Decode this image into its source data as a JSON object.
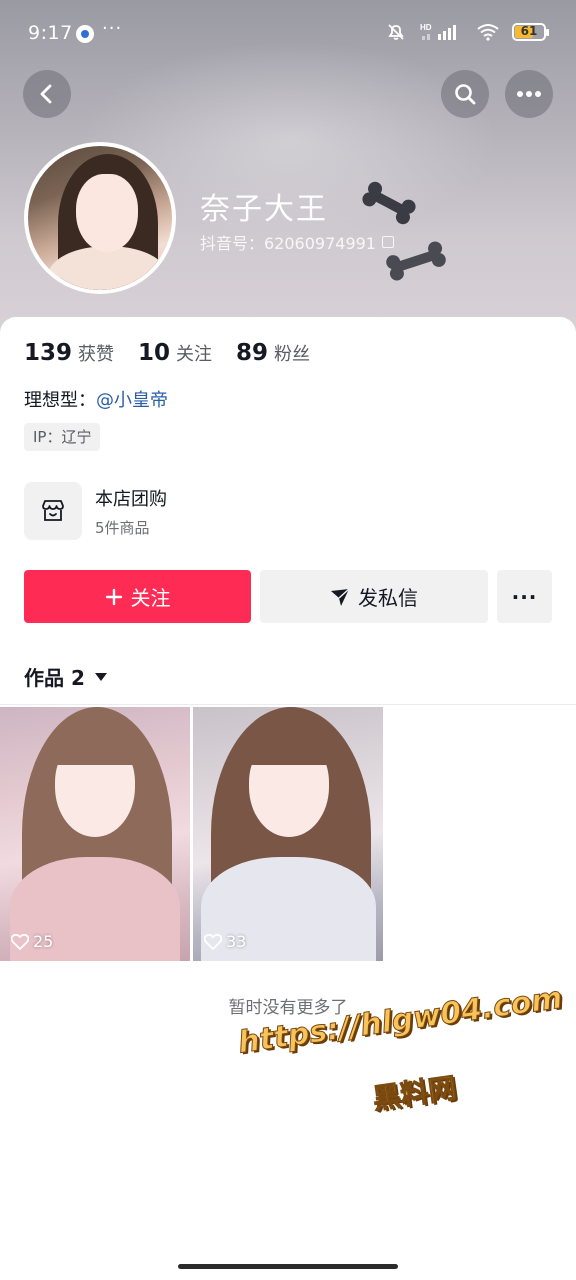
{
  "status_bar": {
    "time": "9:17",
    "dots": "···",
    "signal_label": "HD",
    "battery": {
      "level": 61,
      "label": "61",
      "color": "#f5b932"
    }
  },
  "header": {
    "back_icon": "chevron-left-icon",
    "search_icon": "search-icon",
    "more_icon": "ellipsis-icon"
  },
  "profile": {
    "nickname": "奈子大王",
    "douyin_id": "抖音号：62060974991"
  },
  "stats": {
    "likes": {
      "value": "139",
      "label": "获赞"
    },
    "following": {
      "value": "10",
      "label": "关注"
    },
    "followers": {
      "value": "89",
      "label": "粉丝"
    }
  },
  "bio": {
    "prefix": "理想型：",
    "mention": "@小皇帝"
  },
  "ip_tag": "IP：辽宁",
  "shop": {
    "title": "本店团购",
    "subtitle": "5件商品",
    "icon": "shop-icon"
  },
  "actions": {
    "follow_label": "关注",
    "message_label": "发私信",
    "more_label": "···",
    "accent_color": "#fe2c55"
  },
  "works_tab": {
    "label": "作品 2"
  },
  "videos": [
    {
      "likes": "25"
    },
    {
      "likes": "33"
    }
  ],
  "no_more_text": "暂时没有更多了",
  "watermark": {
    "url": "https://hlgw04.com",
    "name": "黑料网"
  }
}
